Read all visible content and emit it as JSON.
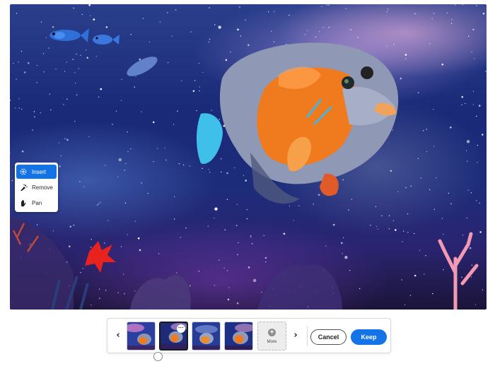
{
  "canvas": {
    "description_icon": "space-fish-image"
  },
  "tools": {
    "items": [
      {
        "label": "Insert",
        "icon": "insert-icon",
        "active": true
      },
      {
        "label": "Remove",
        "icon": "remove-icon",
        "active": false
      },
      {
        "label": "Pan",
        "icon": "pan-hand-icon",
        "active": false
      }
    ]
  },
  "variations": {
    "prev_icon": "chevron-left-icon",
    "next_icon": "chevron-right-icon",
    "prev_glyph": "‹",
    "next_glyph": "›",
    "thumbnails": [
      {
        "selected": false
      },
      {
        "selected": true,
        "options_glyph": "···"
      },
      {
        "selected": false
      },
      {
        "selected": false
      }
    ],
    "more_label": "More",
    "more_glyph": "+"
  },
  "actions": {
    "cancel_label": "Cancel",
    "keep_label": "Keep"
  },
  "colors": {
    "accent": "#1473e6",
    "fish_orange": "#f07a1e",
    "fish_gray": "#8f98b4"
  }
}
